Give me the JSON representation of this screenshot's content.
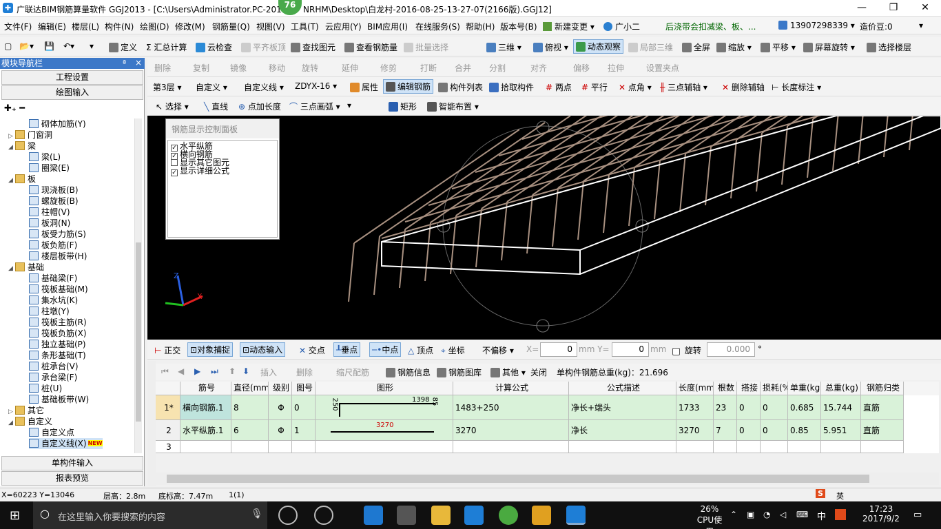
{
  "title": {
    "app_title": "广联达BIM钢筋算量软件 GGJ2013 - [C:\\Users\\Administrator.PC-201",
    "path_tail": "NRHM\\Desktop\\白龙村-2016-08-25-13-27-07(2166版).GGJ12]",
    "badge": "76"
  },
  "window": {
    "minimize": "—",
    "restore": "❐",
    "close": "✕"
  },
  "menu": [
    "文件(F)",
    "编辑(E)",
    "楼层(L)",
    "构件(N)",
    "绘图(D)",
    "修改(M)",
    "钢筋量(Q)",
    "视图(V)",
    "工具(T)",
    "云应用(Y)",
    "BIM应用(I)",
    "在线服务(S)",
    "帮助(H)",
    "版本号(B)",
    "新建变更",
    "广小二",
    "后浇带会扣减梁、板、...",
    "13907298339",
    "造价豆:0"
  ],
  "toolbar1": [
    "定义",
    "Σ 汇总计算",
    "云检查",
    "平齐板顶",
    "查找图元",
    "查看钢筋量",
    "批量选择",
    "三维",
    "俯视",
    "动态观察",
    "局部三维",
    "全屏",
    "缩放",
    "平移",
    "屏幕旋转",
    "选择楼层"
  ],
  "toolbar2": [
    "删除",
    "复制",
    "镜像",
    "移动",
    "旋转",
    "延伸",
    "修剪",
    "打断",
    "合并",
    "分割",
    "对齐",
    "偏移",
    "拉伸",
    "设置夹点"
  ],
  "toolbar3": {
    "floor": "第3层",
    "type": "自定义",
    "sub": "自定义线",
    "name": "ZDYX-16",
    "items": [
      "属性",
      "编辑钢筋",
      "构件列表",
      "拾取构件",
      "两点",
      "平行",
      "点角",
      "三点辅轴",
      "删除辅轴",
      "长度标注"
    ]
  },
  "toolbar4": [
    "选择",
    "直线",
    "点加长度",
    "三点画弧",
    "矩形",
    "智能布置"
  ],
  "sidebar": {
    "header": "模块导航栏",
    "pin": "ª",
    "close": "×",
    "btn_project": "工程设置",
    "btn_draw": "绘图输入",
    "btn_single": "单构件输入",
    "btn_report": "报表预览",
    "tree": [
      {
        "label": "砌体加筋(Y)",
        "indent": 2,
        "type": "leaf"
      },
      {
        "label": "门窗洞",
        "indent": 0,
        "type": "folder",
        "exp": "+"
      },
      {
        "label": "梁",
        "indent": 0,
        "type": "folder",
        "exp": "−"
      },
      {
        "label": "梁(L)",
        "indent": 2,
        "type": "leaf"
      },
      {
        "label": "圈梁(E)",
        "indent": 2,
        "type": "leaf"
      },
      {
        "label": "板",
        "indent": 0,
        "type": "folder",
        "exp": "−"
      },
      {
        "label": "现浇板(B)",
        "indent": 2,
        "type": "leaf"
      },
      {
        "label": "螺旋板(B)",
        "indent": 2,
        "type": "leaf"
      },
      {
        "label": "柱帽(V)",
        "indent": 2,
        "type": "leaf"
      },
      {
        "label": "板洞(N)",
        "indent": 2,
        "type": "leaf"
      },
      {
        "label": "板受力筋(S)",
        "indent": 2,
        "type": "leaf"
      },
      {
        "label": "板负筋(F)",
        "indent": 2,
        "type": "leaf"
      },
      {
        "label": "楼层板带(H)",
        "indent": 2,
        "type": "leaf"
      },
      {
        "label": "基础",
        "indent": 0,
        "type": "folder",
        "exp": "−"
      },
      {
        "label": "基础梁(F)",
        "indent": 2,
        "type": "leaf"
      },
      {
        "label": "筏板基础(M)",
        "indent": 2,
        "type": "leaf"
      },
      {
        "label": "集水坑(K)",
        "indent": 2,
        "type": "leaf"
      },
      {
        "label": "柱墩(Y)",
        "indent": 2,
        "type": "leaf"
      },
      {
        "label": "筏板主筋(R)",
        "indent": 2,
        "type": "leaf"
      },
      {
        "label": "筏板负筋(X)",
        "indent": 2,
        "type": "leaf"
      },
      {
        "label": "独立基础(P)",
        "indent": 2,
        "type": "leaf"
      },
      {
        "label": "条形基础(T)",
        "indent": 2,
        "type": "leaf"
      },
      {
        "label": "桩承台(V)",
        "indent": 2,
        "type": "leaf"
      },
      {
        "label": "承台梁(F)",
        "indent": 2,
        "type": "leaf"
      },
      {
        "label": "桩(U)",
        "indent": 2,
        "type": "leaf"
      },
      {
        "label": "基础板带(W)",
        "indent": 2,
        "type": "leaf"
      },
      {
        "label": "其它",
        "indent": 0,
        "type": "folder",
        "exp": "+"
      },
      {
        "label": "自定义",
        "indent": 0,
        "type": "folder",
        "exp": "−"
      },
      {
        "label": "自定义点",
        "indent": 2,
        "type": "leaf"
      },
      {
        "label": "自定义线(X)",
        "indent": 2,
        "type": "leaf",
        "new": "NEW"
      }
    ]
  },
  "control_panel": {
    "title": "钢筋显示控制面板",
    "options": [
      {
        "label": "水平纵筋",
        "checked": true
      },
      {
        "label": "横向钢筋",
        "checked": true
      },
      {
        "label": "显示其它图元",
        "checked": false
      },
      {
        "label": "显示详细公式",
        "checked": true
      }
    ]
  },
  "snapbar": {
    "items": [
      "正交",
      "对象捕捉",
      "动态输入",
      "交点",
      "垂点",
      "中点",
      "顶点",
      "坐标"
    ],
    "offset": "不偏移",
    "x_label": "X=",
    "x_value": "0",
    "y_label": "mm Y=",
    "y_value": "0",
    "unit": "mm",
    "rotate_label": "旋转",
    "rotate_value": "0.000",
    "degree": "°"
  },
  "gridbar": {
    "items": [
      "插入",
      "删除",
      "缩尺配筋",
      "钢筋信息",
      "钢筋图库",
      "其他",
      "关闭"
    ],
    "total": "单构件钢筋总重(kg)：21.696"
  },
  "table": {
    "headers": [
      "筋号",
      "直径(mm)",
      "级别",
      "图号",
      "图形",
      "计算公式",
      "公式描述",
      "长度(mm)",
      "根数",
      "搭接",
      "损耗(%)",
      "单重(kg)",
      "总重(kg)",
      "钢筋归类"
    ],
    "rows": [
      {
        "no": "1*",
        "name": "横向钢筋.1",
        "dia": "8",
        "grade": "Φ",
        "fig": "0",
        "shape_left": "250",
        "shape_mid": "1398",
        "shape_right": "85",
        "formula": "1483+250",
        "desc": "净长+端头",
        "len": "1733",
        "count": "23",
        "lap": "0",
        "loss": "0",
        "unit": "0.685",
        "total": "15.744",
        "cat": "直筋"
      },
      {
        "no": "2",
        "name": "水平纵筋.1",
        "dia": "6",
        "grade": "Φ",
        "fig": "1",
        "shape_mid": "3270",
        "formula": "3270",
        "desc": "净长",
        "len": "3270",
        "count": "7",
        "lap": "0",
        "loss": "0",
        "unit": "0.85",
        "total": "5.951",
        "cat": "直筋"
      },
      {
        "no": "3"
      }
    ]
  },
  "status": {
    "coords": "X=60223 Y=13046",
    "floor_h": "层高：2.8m",
    "base_h": "底标高：7.47m",
    "count": "1(1)"
  },
  "taskbar": {
    "search": "在这里输入你要搜索的内容",
    "cpu_pct": "26%",
    "cpu_label": "CPU使用",
    "ime": "中",
    "time": "17:23",
    "date": "2017/9/2",
    "ime_en": "英"
  },
  "colors": {
    "grid_green": "#d9f2d9",
    "sidebar_header": "#3c78c8",
    "viewport_bg": "#000000",
    "rebar": "#a89080"
  }
}
